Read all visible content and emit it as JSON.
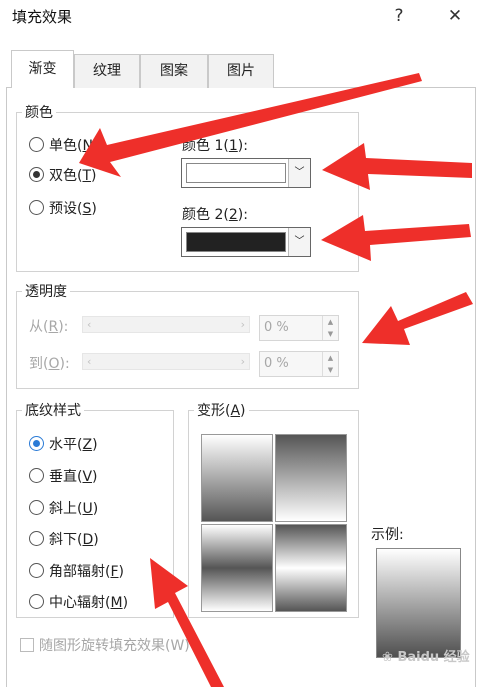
{
  "window": {
    "title": "填充效果",
    "help_label": "?",
    "close_label": "✕"
  },
  "tabs": [
    {
      "label": "渐变",
      "active": true
    },
    {
      "label": "纹理",
      "active": false
    },
    {
      "label": "图案",
      "active": false
    },
    {
      "label": "图片",
      "active": false
    }
  ],
  "colors_group": {
    "legend": "颜色",
    "options": [
      {
        "text": "单色(",
        "key": "N",
        "close": ")",
        "selected": false
      },
      {
        "text": "双色(",
        "key": "T",
        "close": ")",
        "selected": true
      },
      {
        "text": "预设(",
        "key": "S",
        "close": ")",
        "selected": false
      }
    ],
    "color1": {
      "text": "颜色 1(",
      "key": "1",
      "close": "):",
      "value": "#ffffff"
    },
    "color2": {
      "text": "颜色 2(",
      "key": "2",
      "close": "):",
      "value": "#222222"
    }
  },
  "transparency": {
    "legend": "透明度",
    "from": {
      "text": "从(",
      "key": "R",
      "close": "):",
      "value": "0 %"
    },
    "to": {
      "text": "到(",
      "key": "O",
      "close": "):",
      "value": "0 %"
    }
  },
  "shading": {
    "legend": "底纹样式",
    "options": [
      {
        "text": "水平(",
        "key": "Z",
        "close": ")",
        "selected": true
      },
      {
        "text": "垂直(",
        "key": "V",
        "close": ")",
        "selected": false
      },
      {
        "text": "斜上(",
        "key": "U",
        "close": ")",
        "selected": false
      },
      {
        "text": "斜下(",
        "key": "D",
        "close": ")",
        "selected": false
      },
      {
        "text": "角部辐射(",
        "key": "F",
        "close": ")",
        "selected": false
      },
      {
        "text": "中心辐射(",
        "key": "M",
        "close": ")",
        "selected": false
      }
    ]
  },
  "variants": {
    "text": "变形(",
    "key": "A",
    "close": ")"
  },
  "sample": {
    "label": "示例:"
  },
  "rotate_checkbox": {
    "label": "随图形旋转填充效果(W)",
    "checked": false
  },
  "watermark": {
    "text": "Baidu 经验"
  },
  "accent": {
    "arrow": "#ee2f2a",
    "radio_blue": "#2b7bd6"
  }
}
